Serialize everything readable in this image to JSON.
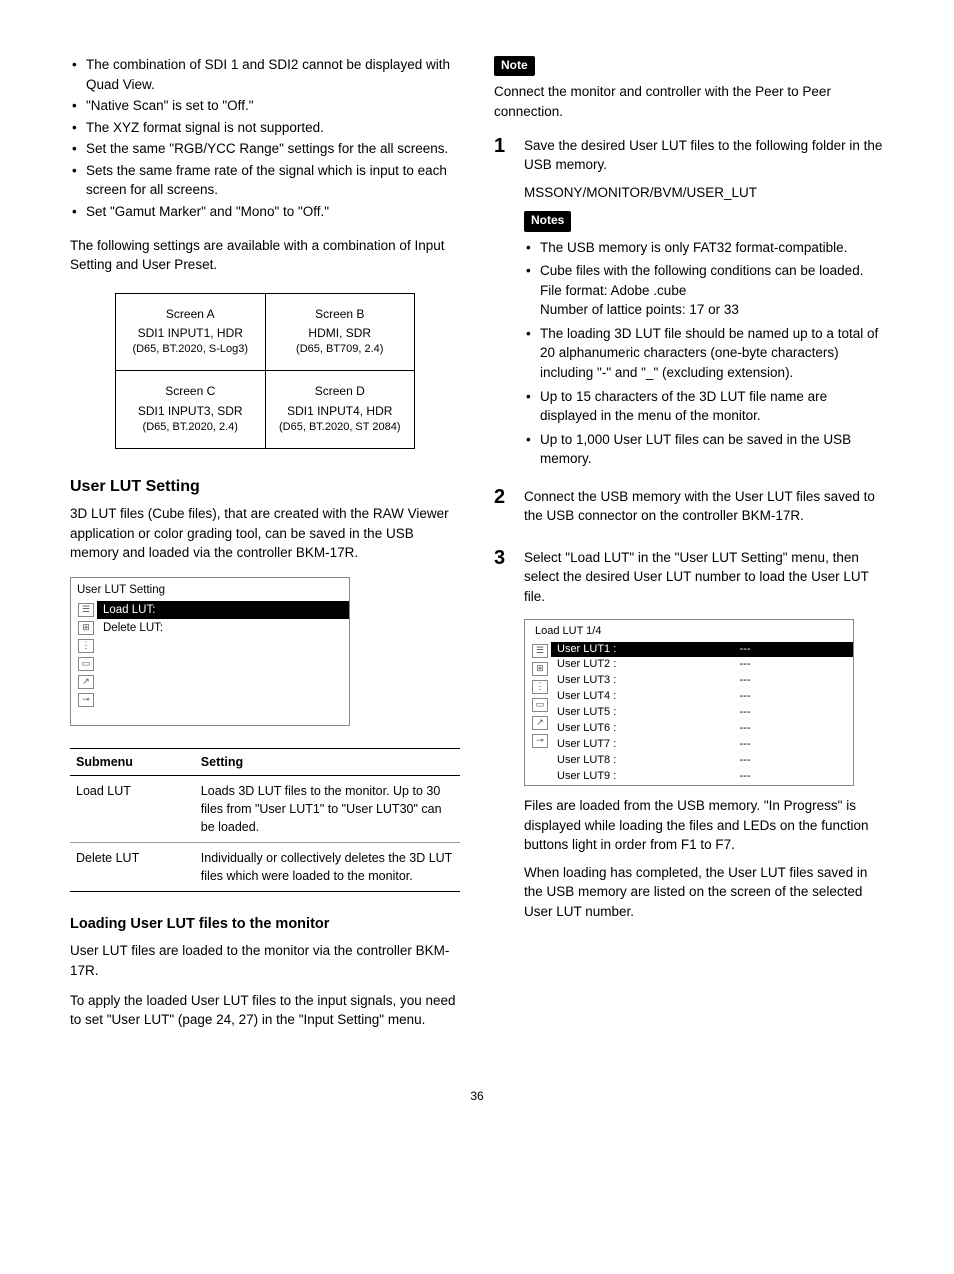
{
  "left": {
    "bullets1": [
      "The combination of SDI 1 and SDI2 cannot be displayed with Quad View.",
      "\"Native Scan\" is set to \"Off.\"",
      "The XYZ format signal is not supported.",
      "Set the same \"RGB/YCC Range\" settings for the all screens.",
      "Sets the same frame rate of the signal which is input to each screen for all screens.",
      "Set \"Gamut Marker\" and \"Mono\" to \"Off.\""
    ],
    "para1": "The following settings are available with a combination of Input Setting and User Preset.",
    "quad": {
      "a": {
        "t": "Screen A",
        "m": "SDI1 INPUT1, HDR",
        "s": "(D65, BT.2020, S-Log3)"
      },
      "b": {
        "t": "Screen B",
        "m": "HDMI, SDR",
        "s": "(D65, BT709, 2.4)"
      },
      "c": {
        "t": "Screen C",
        "m": "SDI1 INPUT3, SDR",
        "s": "(D65, BT.2020, 2.4)"
      },
      "d": {
        "t": "Screen D",
        "m": "SDI1 INPUT4, HDR",
        "s": "(D65, BT.2020, ST 2084)"
      }
    },
    "h_userlut": "User LUT Setting",
    "userlut_desc": "3D LUT files (Cube files), that are created with the RAW Viewer application or color grading tool, can be saved in the USB memory and loaded via the controller BKM-17R.",
    "menu": {
      "title": "User LUT Setting",
      "load": "Load LUT:",
      "delete": "Delete LUT:"
    },
    "submenu": {
      "h1": "Submenu",
      "h2": "Setting",
      "rows": [
        {
          "a": "Load LUT",
          "b": "Loads 3D LUT files to the monitor. Up to 30 files from \"User LUT1\" to \"User LUT30\" can be loaded."
        },
        {
          "a": "Delete LUT",
          "b": "Individually or collectively deletes the 3D LUT files which were loaded to the monitor."
        }
      ]
    },
    "h_loading": "Loading User LUT files to the monitor",
    "loading_p1": "User LUT files are loaded to the monitor via the controller BKM-17R.",
    "loading_p2": "To apply the loaded User LUT files to the input signals, you need to set \"User LUT\" (page 24, 27) in the \"Input Setting\" menu."
  },
  "right": {
    "note_label": "Note",
    "notes_label": "Notes",
    "note_text": "Connect the monitor and controller with the Peer to Peer connection.",
    "step1": {
      "num": "1",
      "p1": "Save the desired User LUT files to the following folder in the USB memory.",
      "p2": "MSSONY/MONITOR/BVM/USER_LUT",
      "notes": [
        "The USB memory is only FAT32 format-compatible.",
        "Cube files with the following conditions can be loaded.\nFile format: Adobe .cube\nNumber of lattice points: 17 or 33",
        "The loading 3D LUT file should be named up to a total of 20 alphanumeric characters (one-byte characters) including \"-\" and \"_\" (excluding extension).",
        "Up to 15 characters of the 3D LUT file name are displayed in the menu of the monitor.",
        "Up to 1,000 User LUT files can be saved in the USB memory."
      ]
    },
    "step2": {
      "num": "2",
      "p1": "Connect the USB memory with the User LUT files saved to the USB connector on the controller BKM-17R."
    },
    "step3": {
      "num": "3",
      "p1": "Select \"Load LUT\" in the \"User LUT Setting\" menu, then select the desired User LUT number to load the User LUT file.",
      "menu_title": "Load LUT 1/4",
      "items": [
        {
          "label": "User LUT1 :",
          "val": "---"
        },
        {
          "label": "User LUT2 :",
          "val": "---"
        },
        {
          "label": "User LUT3 :",
          "val": "---"
        },
        {
          "label": "User LUT4 :",
          "val": "---"
        },
        {
          "label": "User LUT5 :",
          "val": "---"
        },
        {
          "label": "User LUT6 :",
          "val": "---"
        },
        {
          "label": "User LUT7 :",
          "val": "---"
        },
        {
          "label": "User LUT8 :",
          "val": "---"
        },
        {
          "label": "User LUT9 :",
          "val": "---"
        }
      ],
      "p2": "Files are loaded from the USB memory. \"In Progress\" is displayed while loading the files and LEDs on the function buttons light in order from F1 to F7.",
      "p3": "When loading has completed, the User LUT files saved in the USB memory are listed on the screen of the selected User LUT number."
    }
  },
  "page": "36"
}
